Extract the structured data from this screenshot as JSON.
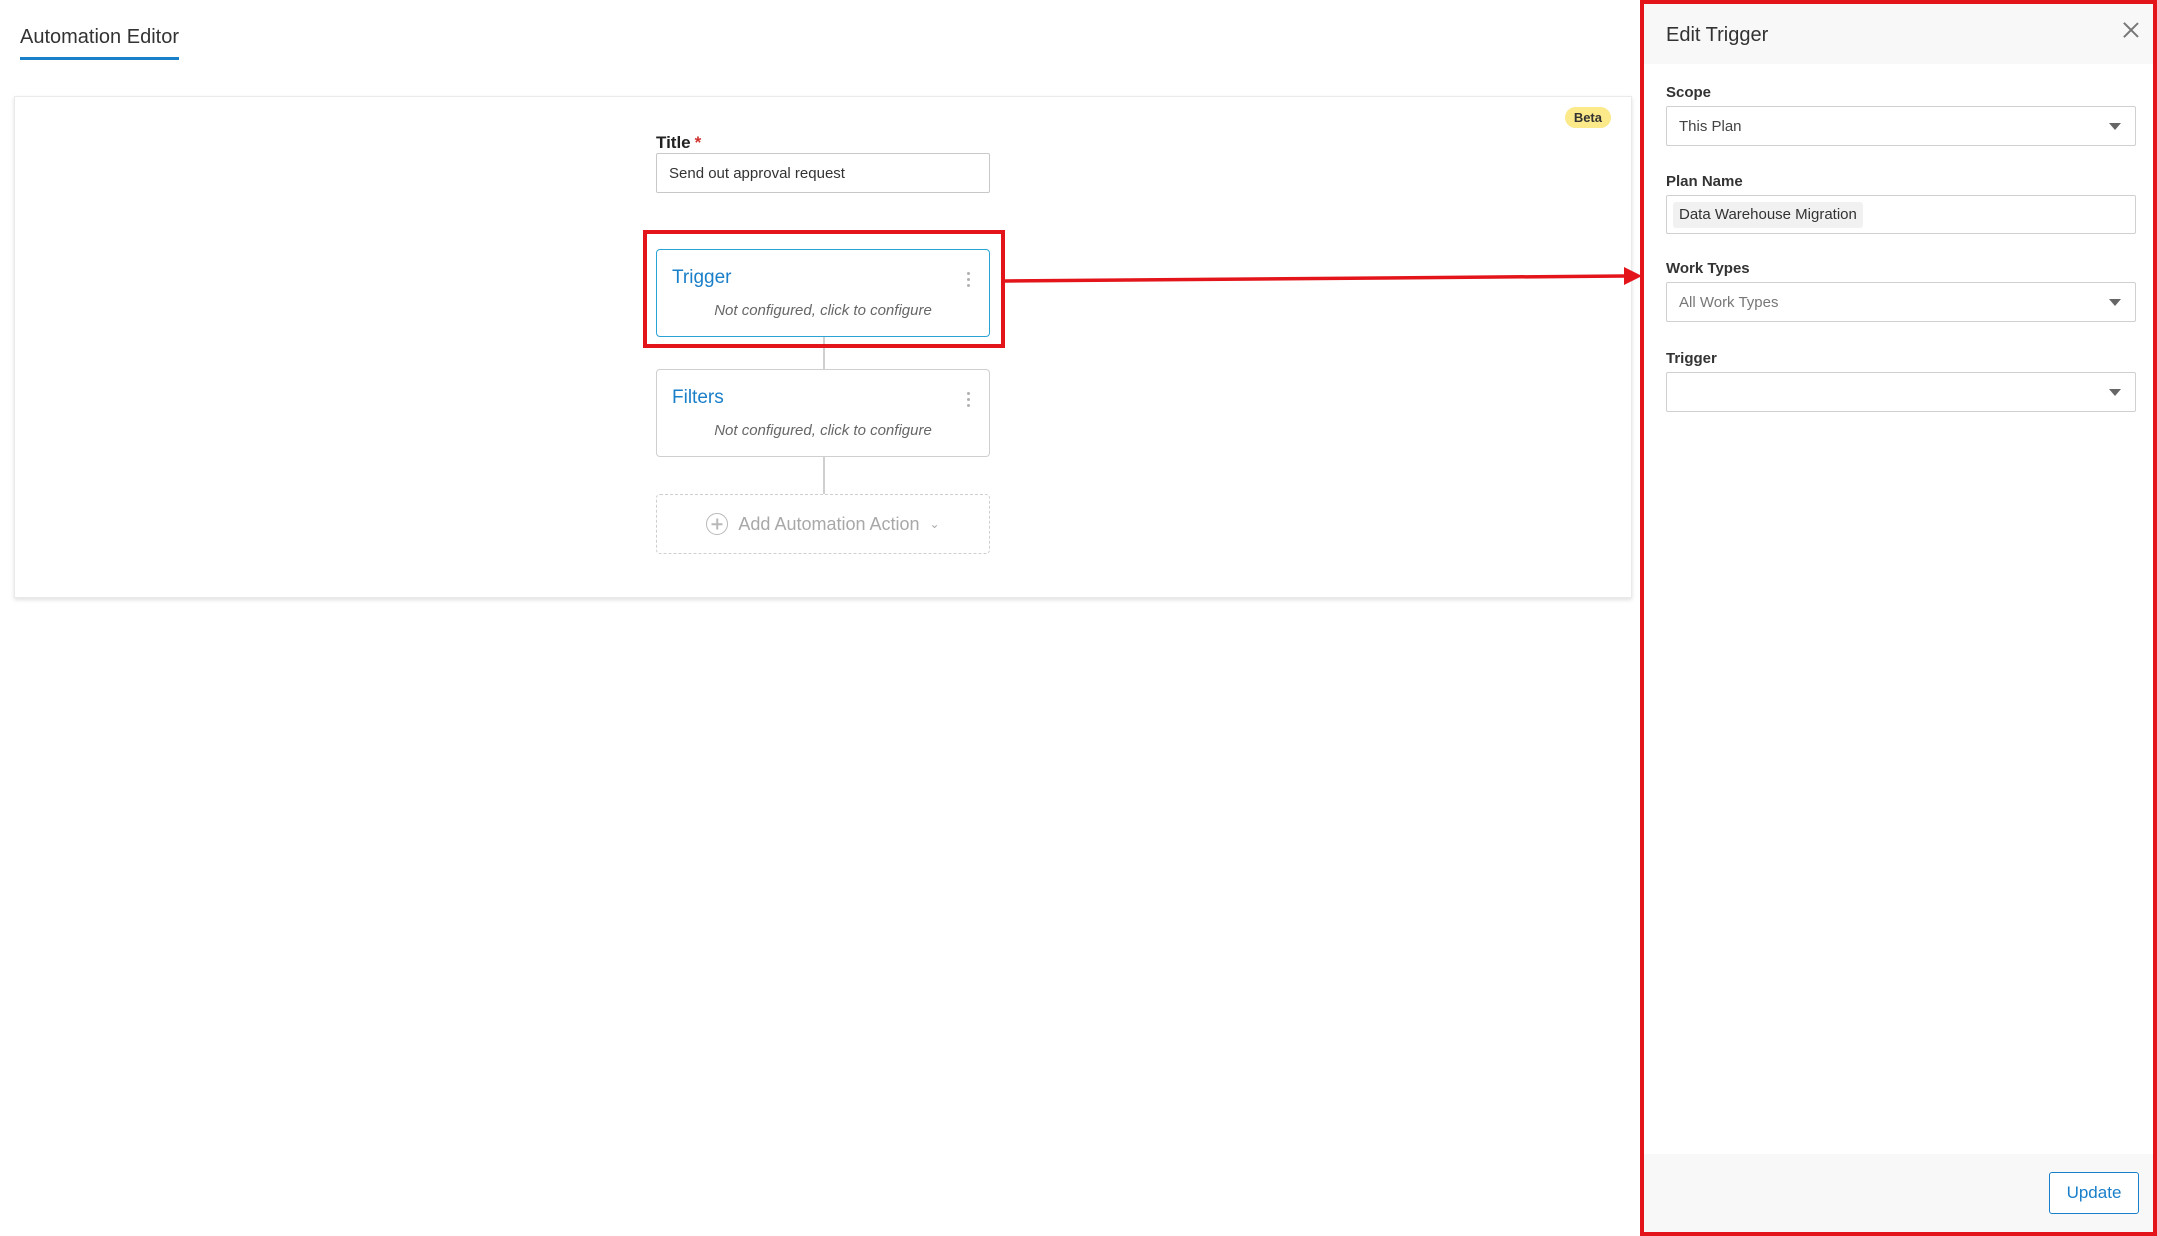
{
  "header": {
    "tab_label": "Automation Editor"
  },
  "editor": {
    "beta_label": "Beta",
    "title_label": "Title",
    "required_marker": "*",
    "title_value": "Send out approval request",
    "nodes": [
      {
        "title": "Trigger",
        "subtitle": "Not configured, click to configure"
      },
      {
        "title": "Filters",
        "subtitle": "Not configured, click to configure"
      }
    ],
    "add_action_label": "Add Automation Action"
  },
  "panel": {
    "title": "Edit Trigger",
    "fields": {
      "scope": {
        "label": "Scope",
        "value": "This Plan"
      },
      "plan_name": {
        "label": "Plan Name",
        "value": "Data Warehouse Migration"
      },
      "work_types": {
        "label": "Work Types",
        "value": "All Work Types"
      },
      "trigger": {
        "label": "Trigger",
        "value": ""
      }
    },
    "update_label": "Update"
  },
  "colors": {
    "accent": "#1a7fc9",
    "highlight": "#e3151a",
    "active_border": "#29a3d6",
    "beta_badge": "#fbe98a"
  },
  "icons": {
    "close": "close-icon",
    "kebab": "kebab-icon",
    "plus": "plus-circle-icon",
    "chevron": "chevron-down-icon",
    "caret": "caret-down-icon"
  }
}
